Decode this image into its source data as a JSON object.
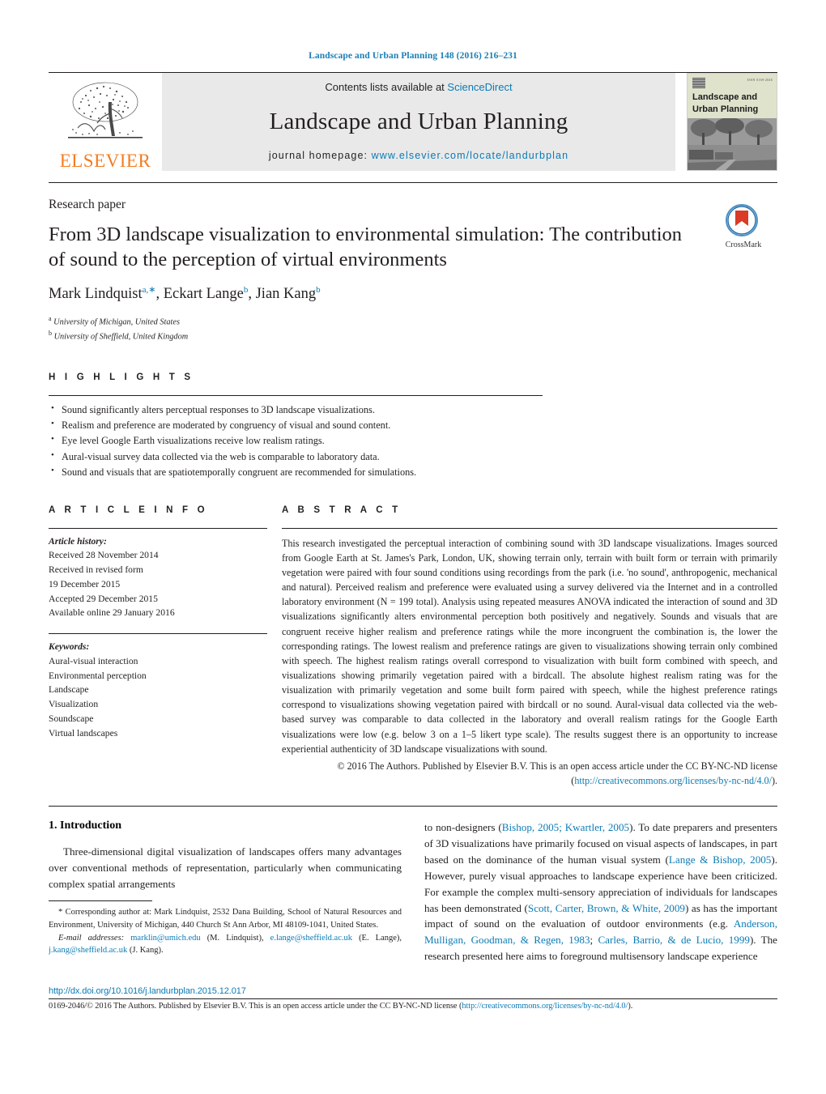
{
  "running_head": "Landscape and Urban Planning 148 (2016) 216–231",
  "masthead": {
    "contents_prefix": "Contents lists available at ",
    "contents_link": "ScienceDirect",
    "journal_name": "Landscape and Urban Planning",
    "homepage_prefix": "journal homepage: ",
    "homepage_link": "www.elsevier.com/locate/landurbplan",
    "publisher": "ELSEVIER",
    "cover": {
      "title_line1": "Landscape and",
      "title_line2": "Urban Planning",
      "issn_text": "ISSN 0169-2046"
    }
  },
  "article": {
    "kicker": "Research paper",
    "title": "From 3D landscape visualization to environmental simulation: The contribution of sound to the perception of virtual environments",
    "authors": [
      {
        "name": "Mark Lindquist",
        "sup": "a,∗"
      },
      {
        "name": "Eckart Lange",
        "sup": "b"
      },
      {
        "name": "Jian Kang",
        "sup": "b"
      }
    ],
    "affiliations": [
      {
        "marker": "a",
        "text": "University of Michigan, United States"
      },
      {
        "marker": "b",
        "text": "University of Sheffield, United Kingdom"
      }
    ],
    "crossmark_label": "CrossMark"
  },
  "highlights": {
    "heading": "H I G H L I G H T S",
    "items": [
      "Sound significantly alters perceptual responses to 3D landscape visualizations.",
      "Realism and preference are moderated by congruency of visual and sound content.",
      "Eye level Google Earth visualizations receive low realism ratings.",
      "Aural-visual survey data collected via the web is comparable to laboratory data.",
      "Sound and visuals that are spatiotemporally congruent are recommended for simulations."
    ]
  },
  "article_info": {
    "heading": "A R T I C L E   I N F O",
    "history_label": "Article history:",
    "history": [
      "Received 28 November 2014",
      "Received in revised form",
      "19 December 2015",
      "Accepted 29 December 2015",
      "Available online 29 January 2016"
    ],
    "keywords_label": "Keywords:",
    "keywords": [
      "Aural-visual interaction",
      "Environmental perception",
      "Landscape",
      "Visualization",
      "Soundscape",
      "Virtual landscapes"
    ]
  },
  "abstract": {
    "heading": "A B S T R A C T",
    "text": "This research investigated the perceptual interaction of combining sound with 3D landscape visualizations. Images sourced from Google Earth at St. James's Park, London, UK, showing terrain only, terrain with built form or terrain with primarily vegetation were paired with four sound conditions using recordings from the park (i.e. 'no sound', anthropogenic, mechanical and natural). Perceived realism and preference were evaluated using a survey delivered via the Internet and in a controlled laboratory environment (N = 199 total). Analysis using repeated measures ANOVA indicated the interaction of sound and 3D visualizations significantly alters environmental perception both positively and negatively. Sounds and visuals that are congruent receive higher realism and preference ratings while the more incongruent the combination is, the lower the corresponding ratings. The lowest realism and preference ratings are given to visualizations showing terrain only combined with speech. The highest realism ratings overall correspond to visualization with built form combined with speech, and visualizations showing primarily vegetation paired with a birdcall. The absolute highest realism rating was for the visualization with primarily vegetation and some built form paired with speech, while the highest preference ratings correspond to visualizations showing vegetation paired with birdcall or no sound. Aural-visual data collected via the web-based survey was comparable to data collected in the laboratory and overall realism ratings for the Google Earth visualizations were low (e.g. below 3 on a 1–5 likert type scale). The results suggest there is an opportunity to increase experiential authenticity of 3D landscape visualizations with sound.",
    "copyright_line1": "© 2016 The Authors. Published by Elsevier B.V. This is an open access article under the CC BY-NC-ND",
    "copyright_line2_prefix": "license (",
    "copyright_link": "http://creativecommons.org/licenses/by-nc-nd/4.0/",
    "copyright_line2_suffix": ")."
  },
  "body": {
    "section_number": "1.",
    "section_title": "Introduction",
    "left_paragraph": "Three-dimensional digital visualization of landscapes offers many advantages over conventional methods of representation, particularly when communicating complex spatial arrangements",
    "right_parts": [
      {
        "t": "to non-designers (",
        "k": "plain"
      },
      {
        "t": "Bishop, 2005; Kwartler, 2005",
        "k": "cite"
      },
      {
        "t": "). To date preparers and presenters of 3D visualizations have primarily focused on visual aspects of landscapes, in part based on the dominance of the human visual system (",
        "k": "plain"
      },
      {
        "t": "Lange & Bishop, 2005",
        "k": "cite"
      },
      {
        "t": "). However, purely visual approaches to landscape experience have been criticized. For example the complex multi-sensory appreciation of individuals for landscapes has been demonstrated (",
        "k": "plain"
      },
      {
        "t": "Scott, Carter, Brown, & White, 2009",
        "k": "cite"
      },
      {
        "t": ") as has the important impact of sound on the evaluation of outdoor environments (e.g. ",
        "k": "plain"
      },
      {
        "t": "Anderson, Mulligan, Goodman, & Regen, 1983",
        "k": "cite"
      },
      {
        "t": "; ",
        "k": "plain"
      },
      {
        "t": "Carles, Barrio, & de Lucio, 1999",
        "k": "cite"
      },
      {
        "t": "). The research presented here aims to foreground multisensory landscape experience",
        "k": "plain"
      }
    ]
  },
  "footnotes": {
    "corresponding": "* Corresponding author at: Mark Lindquist, 2532 Dana Building, School of Natural Resources and Environment, University of Michigan, 440 Church St Ann Arbor, MI 48109-1041, United States.",
    "email_label": "E-mail addresses:",
    "emails": [
      {
        "address": "marklin@umich.edu",
        "owner": "(M. Lindquist),"
      },
      {
        "address": "e.lange@sheffield.ac.uk",
        "owner": "(E. Lange),"
      },
      {
        "address": "j.kang@sheffield.ac.uk",
        "owner": "(J. Kang)."
      }
    ]
  },
  "bottom": {
    "doi": "http://dx.doi.org/10.1016/j.landurbplan.2015.12.017",
    "issn_line_prefix": "0169-2046/© 2016 The Authors. Published by Elsevier B.V. This is an open access article under the CC BY-NC-ND license (",
    "issn_line_link": "http://creativecommons.org/licenses/by-nc-nd/4.0/",
    "issn_line_suffix": ")."
  },
  "colors": {
    "link": "#0b7bb5",
    "elsevier_orange": "#f47c20",
    "rule": "#231f20",
    "masthead_bg": "#e9e9e9"
  }
}
